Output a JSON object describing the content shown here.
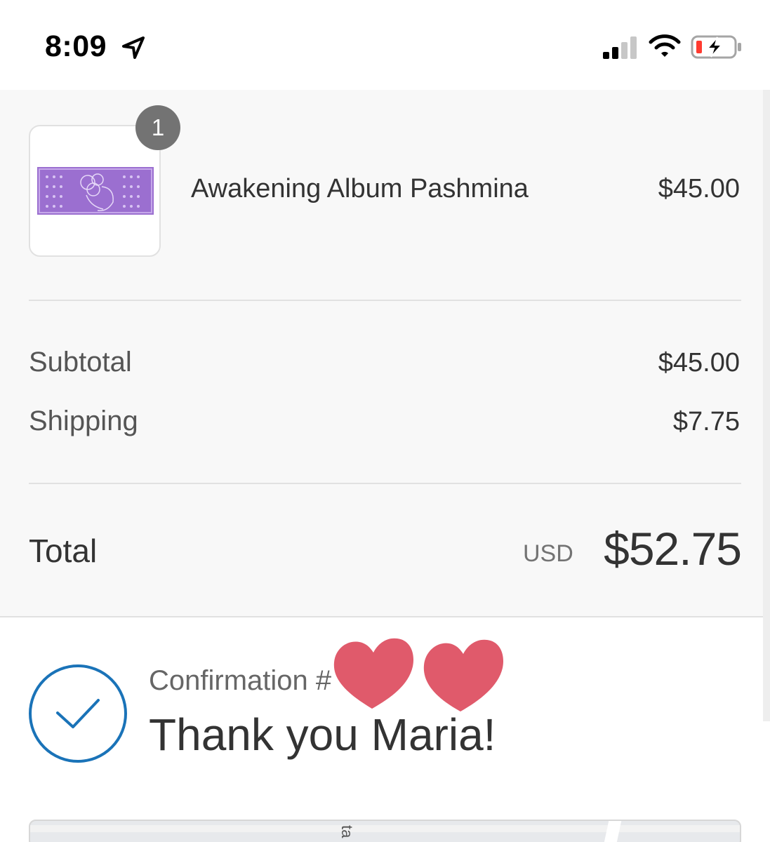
{
  "status_bar": {
    "time": "8:09",
    "icons": [
      "location-arrow-icon",
      "cellular-signal-icon",
      "wifi-icon",
      "battery-charging-icon"
    ]
  },
  "order": {
    "item": {
      "quantity": "1",
      "name": "Awakening Album Pashmina",
      "price": "$45.00",
      "thumbnail_color": "#9b6fd0"
    },
    "subtotal_label": "Subtotal",
    "subtotal_value": "$45.00",
    "shipping_label": "Shipping",
    "shipping_value": "$7.75",
    "total_label": "Total",
    "currency": "USD",
    "total_value": "$52.75"
  },
  "confirmation": {
    "label": "Confirmation #",
    "thanks": "Thank you Maria!",
    "accent_color": "#1a73b8",
    "heart_color": "#e05a6b"
  },
  "map": {
    "street_label": "ta"
  }
}
